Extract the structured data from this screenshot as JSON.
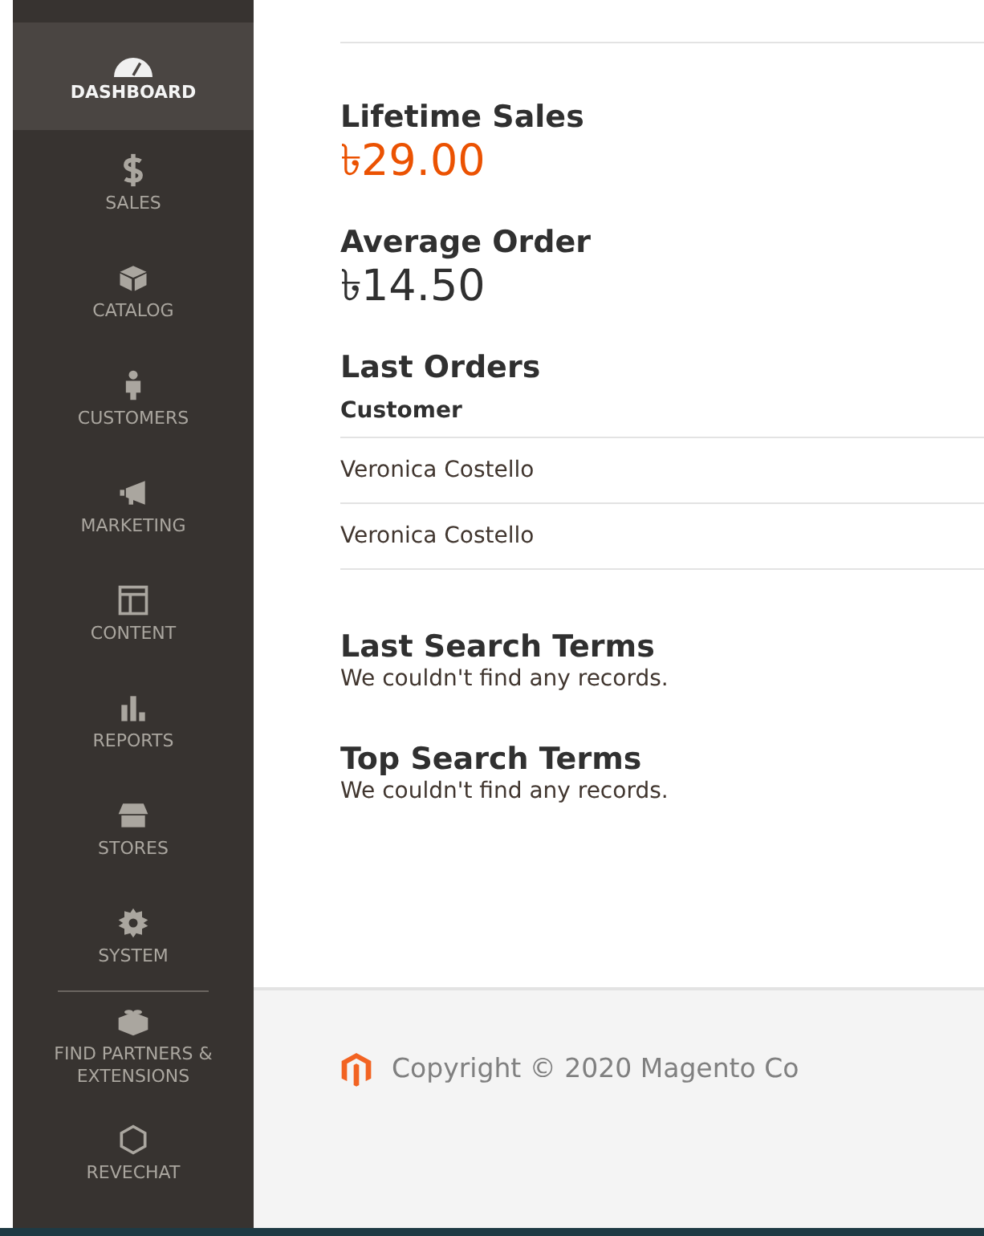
{
  "sidebar": {
    "items": [
      {
        "kind": "dashboard",
        "label": "DASHBOARD",
        "selected": true
      },
      {
        "kind": "sales",
        "label": "SALES",
        "selected": false
      },
      {
        "kind": "catalog",
        "label": "CATALOG",
        "selected": false
      },
      {
        "kind": "customers",
        "label": "CUSTOMERS",
        "selected": false
      },
      {
        "kind": "marketing",
        "label": "MARKETING",
        "selected": false
      },
      {
        "kind": "content",
        "label": "CONTENT",
        "selected": false
      },
      {
        "kind": "reports",
        "label": "REPORTS",
        "selected": false
      },
      {
        "kind": "stores",
        "label": "STORES",
        "selected": false
      },
      {
        "kind": "system",
        "label": "SYSTEM",
        "selected": false
      }
    ],
    "extra_items": [
      {
        "kind": "partners",
        "label": "FIND PARTNERS & EXTENSIONS",
        "selected": false
      },
      {
        "kind": "revechat",
        "label": "REVECHAT",
        "selected": false
      }
    ]
  },
  "stats": [
    {
      "title": "Lifetime Sales",
      "value": "৳29.00",
      "highlight": true
    },
    {
      "title": "Average Order",
      "value": "৳14.50",
      "highlight": false
    }
  ],
  "last_orders": {
    "title": "Last Orders",
    "columns": [
      "Customer"
    ],
    "rows": [
      [
        "Veronica Costello"
      ],
      [
        "Veronica Costello"
      ]
    ]
  },
  "search_sections": [
    {
      "title": "Last Search Terms",
      "message": "We couldn't find any records."
    },
    {
      "title": "Top Search Terms",
      "message": "We couldn't find any records."
    }
  ],
  "footer": {
    "copyright": "Copyright © 2020 Magento Co"
  }
}
